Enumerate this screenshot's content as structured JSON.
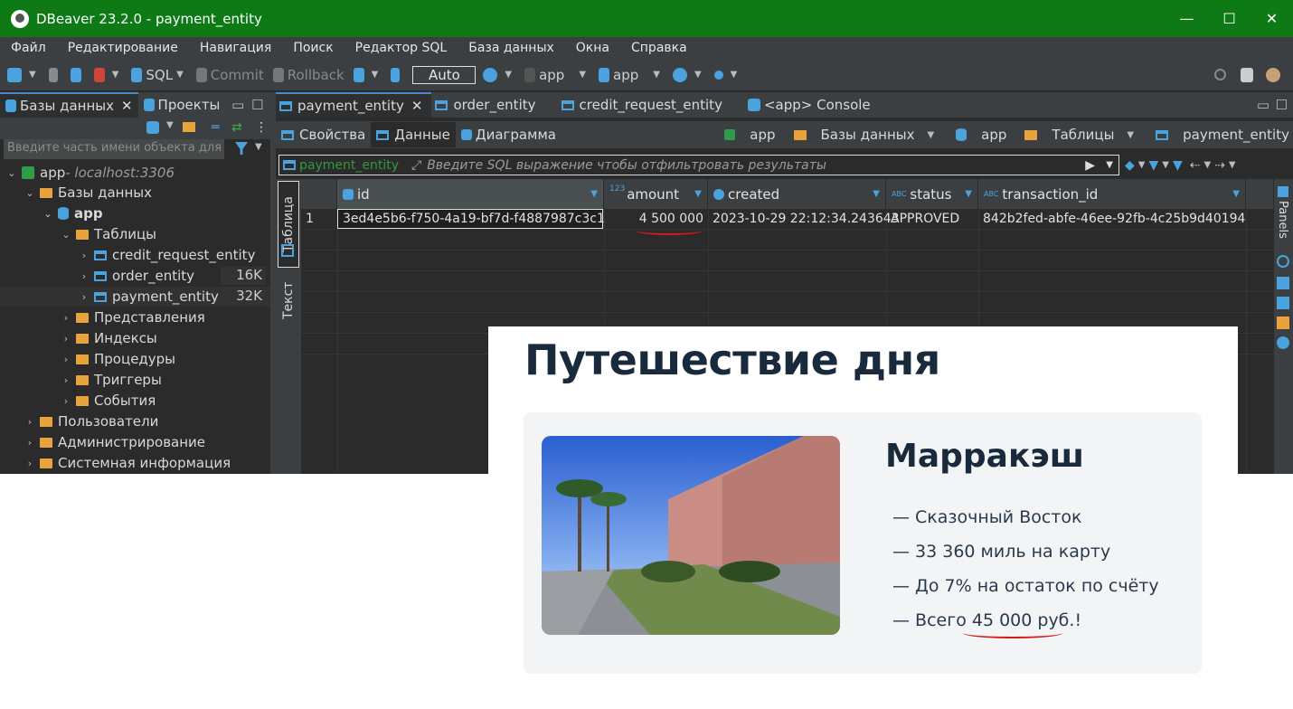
{
  "window": {
    "title": "DBeaver 23.2.0 - payment_entity",
    "minimize": "—",
    "maximize": "☐",
    "close": "✕"
  },
  "menu": [
    "Файл",
    "Редактирование",
    "Навигация",
    "Поиск",
    "Редактор SQL",
    "База данных",
    "Окна",
    "Справка"
  ],
  "toolbar": {
    "sql": "SQL",
    "commit": "Commit",
    "rollback": "Rollback",
    "auto": "Auto",
    "datasource": "app",
    "schema": "app"
  },
  "left_panel": {
    "tab_databases": "Базы данных",
    "tab_projects": "Проекты",
    "search_placeholder": "Введите часть имени объекта для п",
    "tree": {
      "server": "app",
      "server_host": " - localhost:3306",
      "databases": "Базы данных",
      "db": "app",
      "tables": "Таблицы",
      "table_items": [
        {
          "name": "credit_request_entity",
          "size": ""
        },
        {
          "name": "order_entity",
          "size": "16K"
        },
        {
          "name": "payment_entity",
          "size": "32K"
        }
      ],
      "folders": [
        "Представления",
        "Индексы",
        "Процедуры",
        "Триггеры",
        "События"
      ],
      "top_items": [
        "Пользователи",
        "Администрирование",
        "Системная информация"
      ]
    }
  },
  "editor": {
    "tabs": [
      "payment_entity",
      "order_entity",
      "credit_request_entity",
      "<app> Console"
    ],
    "subtabs": [
      "Свойства",
      "Данные",
      "Диаграмма"
    ],
    "breadcrumbs": [
      "app",
      "Базы данных",
      "app",
      "Таблицы",
      "payment_entity"
    ],
    "filter_table": "payment_entity",
    "filter_placeholder": "Введите SQL выражение чтобы отфильтровать результаты",
    "side_tabs": [
      "Таблица",
      "Текст"
    ],
    "right_panel_label": "Panels"
  },
  "grid": {
    "columns": [
      {
        "type": "",
        "name": "id"
      },
      {
        "type": "123",
        "name": "amount"
      },
      {
        "type": "",
        "name": "created"
      },
      {
        "type": "ABC",
        "name": "status"
      },
      {
        "type": "ABC",
        "name": "transaction_id"
      }
    ],
    "rows": [
      {
        "num": "1",
        "id": "3ed4e5b6-f750-4a19-bf7d-f4887987c3c1",
        "amount": "4 500 000",
        "created": "2023-10-29 22:12:34.243643",
        "status": "APPROVED",
        "transaction_id": "842b2fed-abfe-46ee-92fb-4c25b9d40194"
      }
    ]
  },
  "overlay": {
    "title": "Путешествие дня",
    "city": "Марракэш",
    "features": [
      "—  Сказочный Восток",
      "—  33 360 миль на карту",
      "—  До 7% на остаток по счёту",
      "—  Всего 45 000 руб.!"
    ]
  },
  "colors": {
    "titlebar": "#0e7a16",
    "annotation": "#d61a1a",
    "heading": "#1a2a3d"
  }
}
